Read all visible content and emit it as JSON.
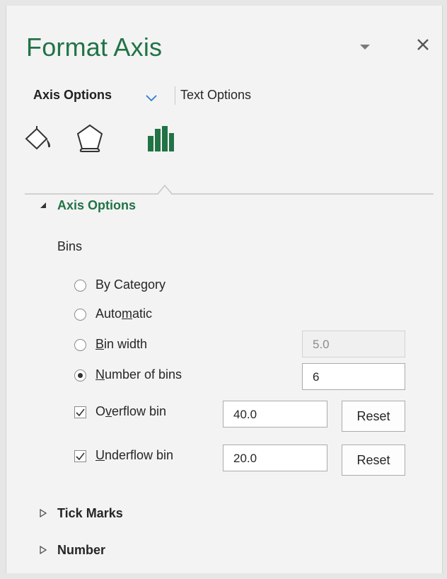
{
  "pane": {
    "title": "Format Axis",
    "accent_color": "#217346",
    "dropdown_icon": "triangle-down-icon",
    "close_icon": "close-icon"
  },
  "tabs": {
    "axis_options": "Axis Options",
    "text_options": "Text Options"
  },
  "icon_tabs": [
    {
      "name": "fill-line-icon"
    },
    {
      "name": "effects-icon"
    },
    {
      "name": "axis-options-icon",
      "selected": true
    }
  ],
  "section": {
    "title": "Axis Options",
    "expanded": true,
    "group_label": "Bins"
  },
  "bins": {
    "by_category": "By Category",
    "automatic": "Automatic",
    "bin_width": {
      "label": "Bin width",
      "value": "5.0",
      "enabled": false
    },
    "number_of_bins": {
      "label": "Number of bins",
      "value": "6",
      "selected": true
    },
    "overflow": {
      "label": "Overflow bin",
      "checked": true,
      "value": "40.0",
      "reset": "Reset"
    },
    "underflow": {
      "label": "Underflow bin",
      "checked": true,
      "value": "20.0",
      "reset": "Reset"
    }
  },
  "collapsed_sections": [
    "Tick Marks",
    "Number"
  ]
}
